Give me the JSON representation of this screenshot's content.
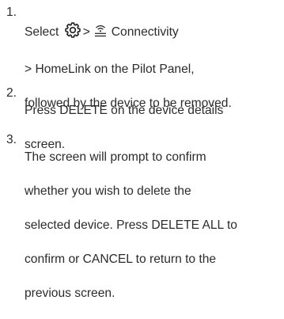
{
  "steps": [
    {
      "number": "1.",
      "prefix": "Select",
      "separator": ">",
      "icons": [
        "gear-icon",
        "wireless-icon"
      ],
      "menu_item": "Connectivity",
      "line2": "> HomeLink on the Pilot Panel,",
      "line3": "followed by the device to be removed."
    },
    {
      "number": "2.",
      "line1": "Press DELETE on the device details",
      "line2": "screen."
    },
    {
      "number": "3.",
      "line1": "The screen will prompt to confirm",
      "line2": "whether you wish to delete the",
      "line3": "selected device. Press DELETE ALL to",
      "line4": "confirm or CANCEL to return to the",
      "line5": "previous screen."
    }
  ]
}
